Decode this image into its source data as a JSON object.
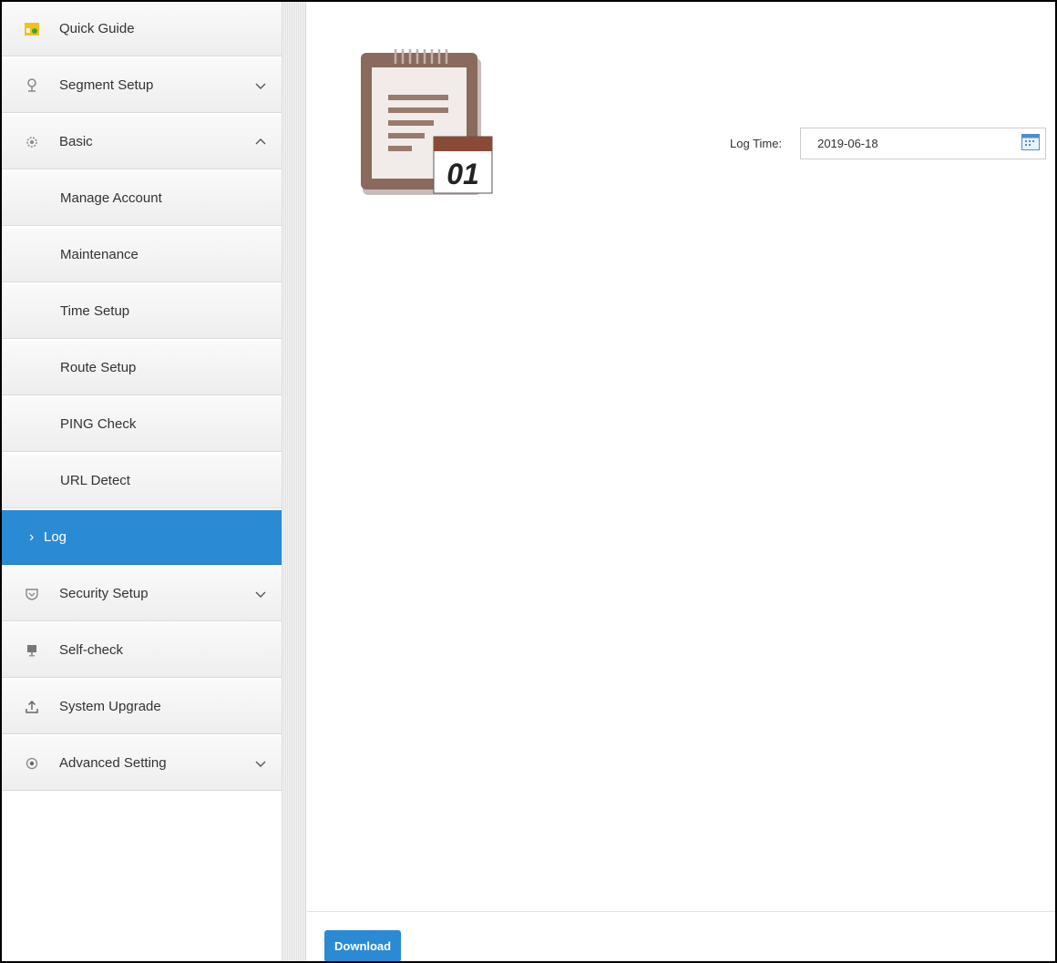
{
  "sidebar": {
    "quick_guide": "Quick Guide",
    "segment_setup": "Segment Setup",
    "basic": "Basic",
    "sub": {
      "manage_account": "Manage Account",
      "maintenance": "Maintenance",
      "time_setup": "Time Setup",
      "route_setup": "Route Setup",
      "ping_check": "PING Check",
      "url_detect": "URL Detect",
      "log": "Log"
    },
    "security_setup": "Security Setup",
    "self_check": "Self-check",
    "system_upgrade": "System Upgrade",
    "advanced_setting": "Advanced Setting"
  },
  "main": {
    "logo_number": "01",
    "log_time_label": "Log Time:",
    "log_time_value": "2019-06-18",
    "download_label": "Download"
  },
  "colors": {
    "accent": "#2b8ad4",
    "notepad_brown": "#8a6a5c"
  }
}
